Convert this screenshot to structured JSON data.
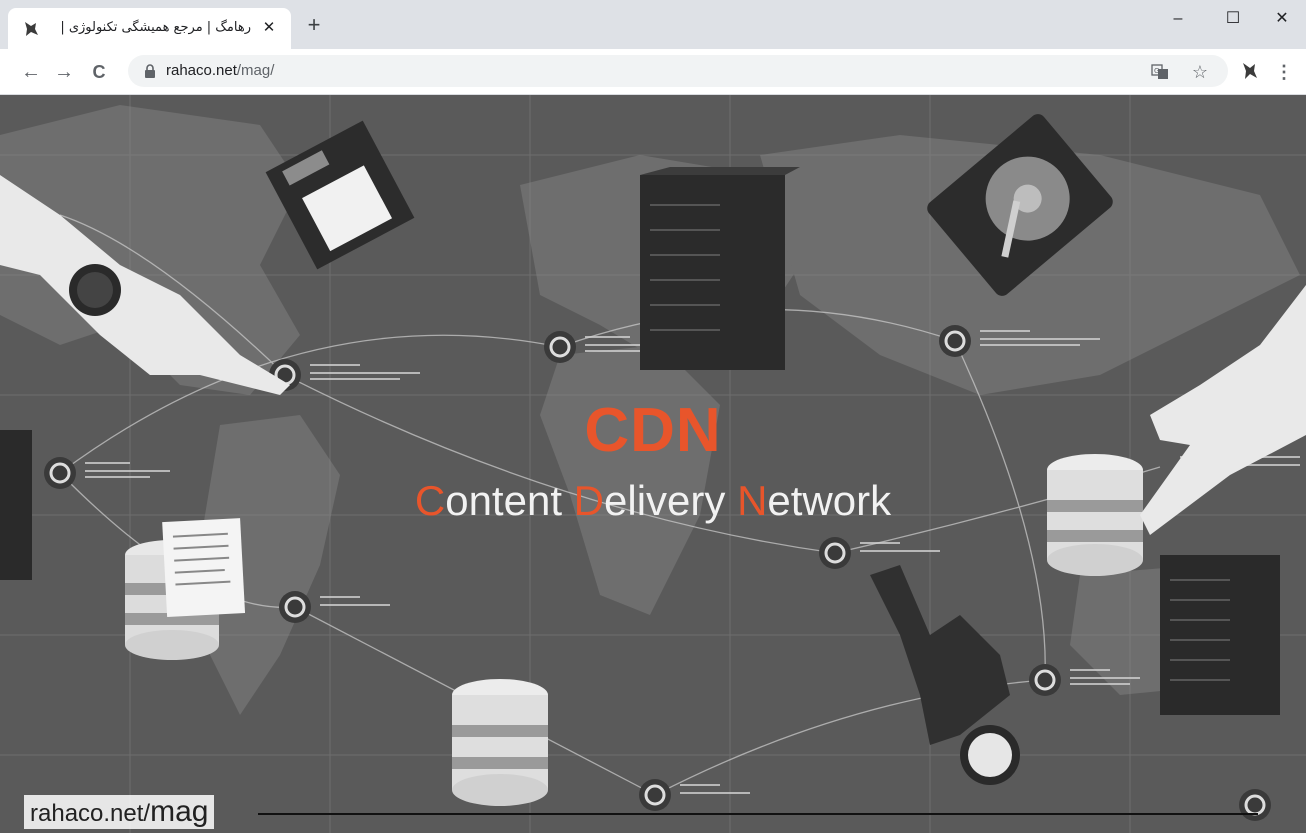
{
  "browser": {
    "tab": {
      "title": "رهامگ | مرجع همیشگی تکنولوژی |",
      "close_glyph": "✕"
    },
    "new_tab_glyph": "+",
    "window": {
      "minimize": "–",
      "maximize": "☐",
      "close": "✕"
    },
    "nav": {
      "back": "←",
      "forward": "→",
      "reload": "C"
    },
    "address": {
      "host": "rahaco.net",
      "path": "/mag/"
    },
    "toolbar_icons": {
      "translate": "translate-icon",
      "bookmark": "☆",
      "menu": "⋮"
    }
  },
  "hero": {
    "title": "CDN",
    "subtitle_parts": [
      {
        "text": "C",
        "highlight": true
      },
      {
        "text": "ontent ",
        "highlight": false
      },
      {
        "text": "D",
        "highlight": true
      },
      {
        "text": "elivery ",
        "highlight": false
      },
      {
        "text": "N",
        "highlight": true
      },
      {
        "text": "etwork",
        "highlight": false
      }
    ]
  },
  "footer": {
    "prefix": "rahaco.net/",
    "suffix": "mag"
  },
  "colors": {
    "accent": "#e8552b",
    "background": "#5a5a5a",
    "chrome": "#dee1e6"
  }
}
